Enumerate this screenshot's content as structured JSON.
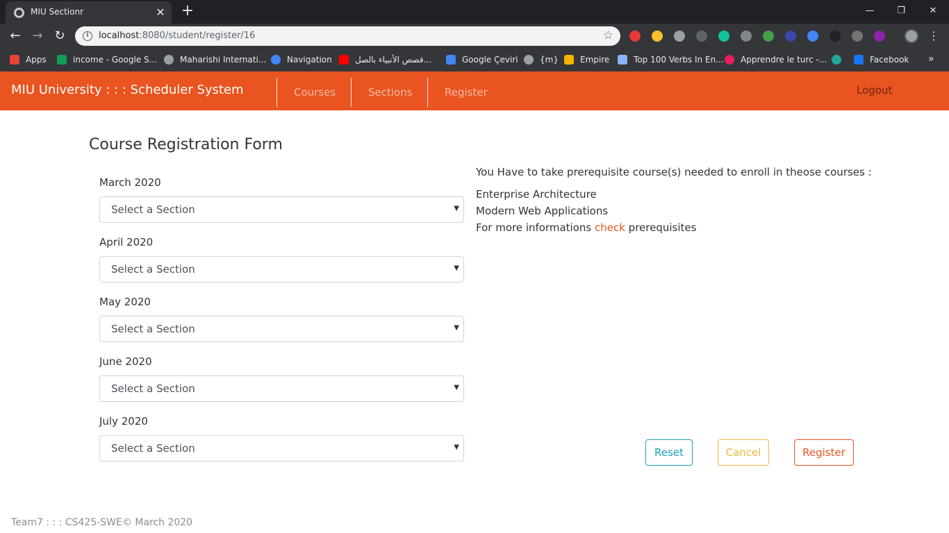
{
  "browser": {
    "tab_title": "MIU Sectionr",
    "url_host": "localhost",
    "url_rest": ":8080/student/register/16",
    "bookmarks": [
      {
        "label": "Apps",
        "color": "#ea4335"
      },
      {
        "label": "income - Google S...",
        "color": "#0f9d58"
      },
      {
        "label": "Maharishi Internati...",
        "color": "#9aa0a6"
      },
      {
        "label": "Navigation",
        "color": "#4285f4"
      },
      {
        "label": "قصص الأنبياء بالصل...",
        "color": "#ff0000"
      },
      {
        "label": "Google Çeviri",
        "color": "#4285f4"
      },
      {
        "label": "{m}",
        "color": "#9aa0a6"
      },
      {
        "label": "Empire",
        "color": "#f4b400"
      },
      {
        "label": "Top 100 Verbs In En...",
        "color": "#8ab4f8"
      },
      {
        "label": "Apprendre le turc -...",
        "color": "#e91e63"
      },
      {
        "label": "",
        "color": "#26a69a"
      },
      {
        "label": "Facebook",
        "color": "#1877f2"
      }
    ]
  },
  "navbar": {
    "brand": "MIU University : : : Scheduler System",
    "items": [
      "Courses",
      "Sections",
      "Register"
    ],
    "logout": "Logout"
  },
  "form": {
    "title": "Course Registration Form",
    "blocks": [
      {
        "month": "March 2020",
        "value": "Select a Section"
      },
      {
        "month": "April 2020",
        "value": "Select a Section"
      },
      {
        "month": "May 2020",
        "value": "Select a Section"
      },
      {
        "month": "June 2020",
        "value": "Select a Section"
      },
      {
        "month": "July 2020",
        "value": "Select a Section"
      }
    ]
  },
  "prereq": {
    "notice": "You Have to take prerequisite course(s) needed to enroll in theose courses :",
    "courses": [
      "Enterprise Architecture",
      "Modern Web Applications"
    ],
    "more_prefix": "For more informations ",
    "more_link": "check",
    "more_suffix": " prerequisites"
  },
  "buttons": {
    "reset": "Reset",
    "cancel": "Cancel",
    "register": "Register"
  },
  "footer": "Team7 : : : CS425-SWE© March 2020"
}
